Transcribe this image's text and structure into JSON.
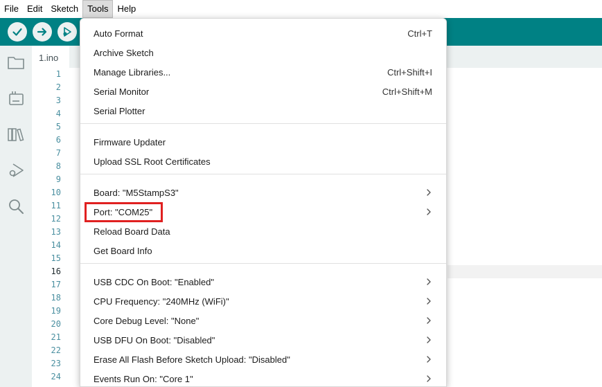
{
  "menubar": {
    "items": [
      {
        "label": "File"
      },
      {
        "label": "Edit"
      },
      {
        "label": "Sketch"
      },
      {
        "label": "Tools"
      },
      {
        "label": "Help"
      }
    ]
  },
  "toolbar": {
    "verify_icon": "check-icon",
    "upload_icon": "arrow-right-icon",
    "debug_icon": "debug-play-icon"
  },
  "sidebar": {
    "icons": [
      "folder-icon",
      "board-icon",
      "library-icon",
      "debug-icon",
      "search-icon"
    ]
  },
  "editor": {
    "tab_label": "1.ino",
    "line_numbers": [
      "1",
      "2",
      "3",
      "4",
      "5",
      "6",
      "7",
      "8",
      "9",
      "10",
      "11",
      "12",
      "13",
      "14",
      "15",
      "16",
      "17",
      "18",
      "19",
      "20",
      "21",
      "22",
      "23",
      "24"
    ],
    "current_line": "16"
  },
  "tools_menu": {
    "groups": [
      [
        {
          "label": "Auto Format",
          "shortcut": "Ctrl+T"
        },
        {
          "label": "Archive Sketch",
          "shortcut": ""
        },
        {
          "label": "Manage Libraries...",
          "shortcut": "Ctrl+Shift+I"
        },
        {
          "label": "Serial Monitor",
          "shortcut": "Ctrl+Shift+M"
        },
        {
          "label": "Serial Plotter",
          "shortcut": ""
        }
      ],
      [
        {
          "label": "Firmware Updater",
          "shortcut": ""
        },
        {
          "label": "Upload SSL Root Certificates",
          "shortcut": ""
        }
      ],
      [
        {
          "label": "Board: \"M5StampS3\"",
          "submenu": true
        },
        {
          "label": "Port: \"COM25\"",
          "submenu": true,
          "highlighted": true
        },
        {
          "label": "Reload Board Data",
          "shortcut": ""
        },
        {
          "label": "Get Board Info",
          "shortcut": ""
        }
      ],
      [
        {
          "label": "USB CDC On Boot: \"Enabled\"",
          "submenu": true
        },
        {
          "label": "CPU Frequency: \"240MHz (WiFi)\"",
          "submenu": true
        },
        {
          "label": "Core Debug Level: \"None\"",
          "submenu": true
        },
        {
          "label": "USB DFU On Boot: \"Disabled\"",
          "submenu": true
        },
        {
          "label": "Erase All Flash Before Sketch Upload: \"Disabled\"",
          "submenu": true
        },
        {
          "label": "Events Run On: \"Core 1\"",
          "submenu": true
        }
      ]
    ]
  },
  "colors": {
    "toolbar": "#008184",
    "sidebar": "#ecf1f1",
    "highlight_box": "#e02020"
  }
}
